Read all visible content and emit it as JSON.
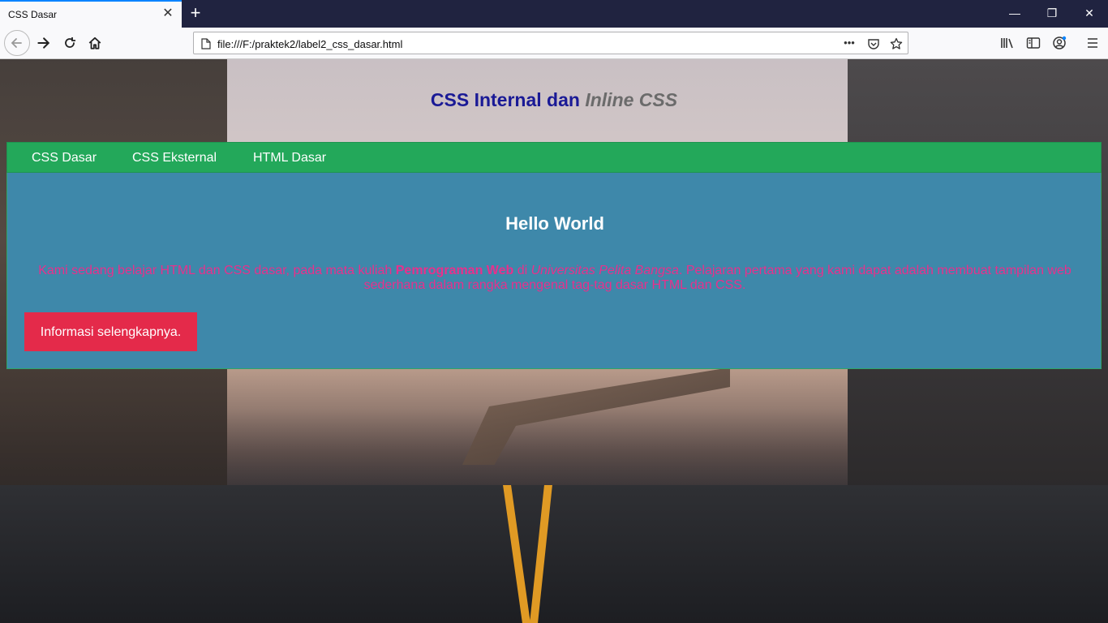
{
  "browser": {
    "tab_title": "CSS Dasar",
    "tab_close": "✕",
    "new_tab": "+",
    "window_controls": {
      "minimize": "—",
      "restore": "❐",
      "close": "✕"
    },
    "url": "file:///F:/praktek2/label2_css_dasar.html",
    "page_actions": "•••",
    "icons": [
      "back-icon",
      "forward-icon",
      "reload-icon",
      "home-icon",
      "page-icon",
      "pocket-icon",
      "bookmark-star-icon",
      "library-icon",
      "sidebar-icon",
      "account-icon",
      "menu-icon"
    ],
    "accent_color": "#0a84ff"
  },
  "page": {
    "heading_main": "CSS Internal dan ",
    "heading_em": "Inline CSS",
    "nav": [
      {
        "label": "CSS Dasar"
      },
      {
        "label": "CSS Eksternal"
      },
      {
        "label": "HTML Dasar"
      }
    ],
    "content": {
      "title": "Hello World",
      "text_part1": "Kami sedang belajar HTML dan CSS dasar, pada mata kuliah ",
      "text_bold": "Pemrograman Web",
      "text_part2": " di ",
      "text_italic": "Universitas Pelita Bangsa",
      "text_part3": ". Pelajaran pertama yang kami dapat adalah membuat tampilan web sederhana dalam rangka mengenal tag-tag dasar HTML dan CSS.",
      "button_label": "Informasi selengkapnya."
    },
    "colors": {
      "nav_bg": "#23a85a",
      "content_bg": "#3e88aa",
      "text_color": "#e8308c",
      "button_bg": "#e42a4a",
      "heading_color": "#1a1a96"
    }
  }
}
